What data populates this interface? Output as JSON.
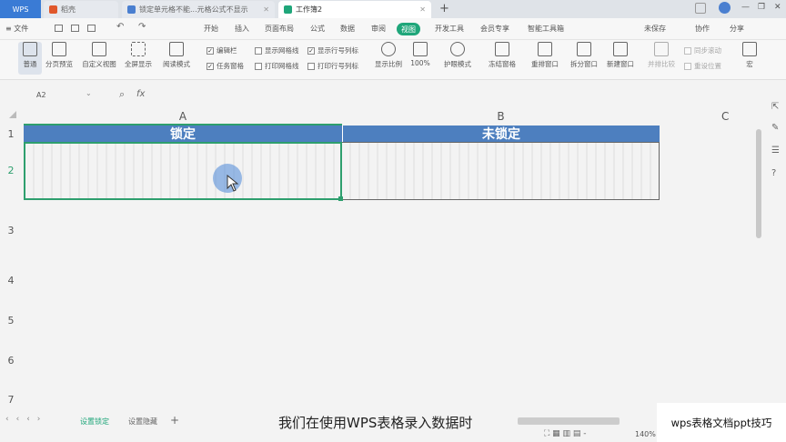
{
  "tabs": {
    "logo": "WPS",
    "tab1": "稻壳",
    "tab2": "锁定单元格不能...元格公式不显示",
    "tab3": "工作簿2",
    "add": "+"
  },
  "window_controls": {
    "minimize": "—",
    "maximize": "❐",
    "close": "✕"
  },
  "menubar": {
    "file": "≡ 文件",
    "items": [
      "开始",
      "插入",
      "页面布局",
      "公式",
      "数据",
      "审阅",
      "视图",
      "开发工具",
      "会员专享",
      "智能工具箱"
    ],
    "active": "视图",
    "unsaved": "未保存",
    "collab": "协作",
    "share": "分享"
  },
  "ribbon": {
    "normal": "普通",
    "page_break": "分页预览",
    "custom_view": "自定义视图",
    "fullscreen": "全屏显示",
    "reading": "阅读模式",
    "edit_bar": "编辑栏",
    "task_pane": "任务窗格",
    "show_grid": "显示网格线",
    "print_grid": "打印网格线",
    "show_rowcol": "显示行号列标",
    "print_rowcol": "打印行号列标",
    "zoom": "显示比例",
    "zoom100": "100%",
    "eye": "护眼模式",
    "freeze": "冻结窗格",
    "rearrange": "重排窗口",
    "split": "拆分窗口",
    "new_window": "新建窗口",
    "side_by_side": "并排比较",
    "sync_scroll": "同步滚动",
    "reset_pos": "重设位置",
    "macro": "宏"
  },
  "formula": {
    "cell_ref": "A2",
    "fx": "fx",
    "value": ""
  },
  "columns": [
    "A",
    "B",
    "C"
  ],
  "rows": [
    "1",
    "2",
    "3",
    "4",
    "5",
    "6",
    "7"
  ],
  "cells": {
    "A1": "锁定",
    "B1": "未锁定",
    "A2": "",
    "B2": ""
  },
  "sheets": {
    "sheet1": "设置锁定",
    "sheet2": "设置隐藏",
    "add": "+"
  },
  "subtitle": "我们在使用WPS表格录入数据时",
  "zoom": "140%",
  "watermark": "wps表格文档ppt技巧",
  "colors": {
    "header_blue": "#4d7fbf",
    "accent_green": "#1fa67a",
    "selection": "#2e9f6e"
  }
}
